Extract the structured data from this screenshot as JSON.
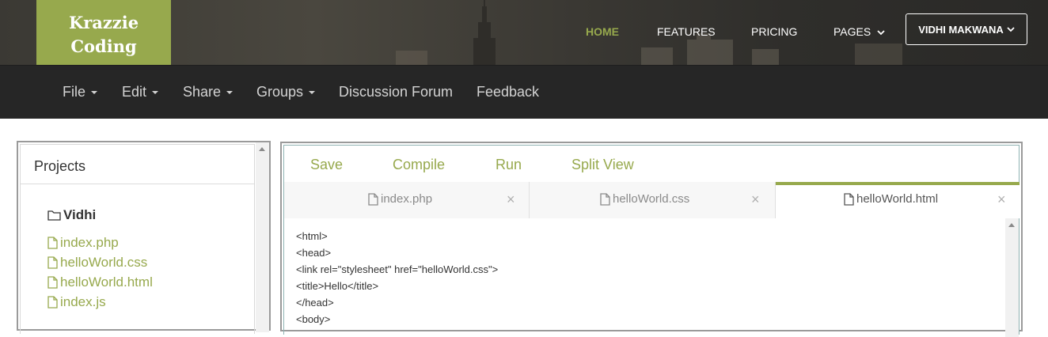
{
  "header": {
    "logo_line1": "Krazzie",
    "logo_line2": "Coding",
    "nav": [
      {
        "label": "HOME",
        "active": true
      },
      {
        "label": "FEATURES",
        "active": false
      },
      {
        "label": "PRICING",
        "active": false
      },
      {
        "label": "PAGES",
        "active": false
      }
    ],
    "user_label": "VIDHI MAKWANA",
    "accent_color": "#97a94d"
  },
  "menu": {
    "items": [
      {
        "label": "File",
        "has_dropdown": true
      },
      {
        "label": "Edit",
        "has_dropdown": true
      },
      {
        "label": "Share",
        "has_dropdown": true
      },
      {
        "label": "Groups",
        "has_dropdown": true
      },
      {
        "label": "Discussion Forum",
        "has_dropdown": false
      },
      {
        "label": "Feedback",
        "has_dropdown": false
      }
    ]
  },
  "projects": {
    "title": "Projects",
    "folder": "Vidhi",
    "files": [
      "index.php",
      "helloWorld.css",
      "helloWorld.html",
      "index.js"
    ]
  },
  "editor": {
    "toolbar": {
      "save": "Save",
      "compile": "Compile",
      "run": "Run",
      "split_view": "Split View"
    },
    "tabs": [
      {
        "label": "index.php",
        "active": false
      },
      {
        "label": "helloWorld.css",
        "active": false
      },
      {
        "label": "helloWorld.html",
        "active": true
      }
    ],
    "close_glyph": "×",
    "code_lines": [
      "<html>",
      "<head>",
      "<link rel=\"stylesheet\" href=\"helloWorld.css\">",
      "<title>Hello</title>",
      "</head>",
      "<body>"
    ]
  },
  "icons": {
    "folder": "folder-icon",
    "file": "file-icon",
    "caret": "caret-down-icon"
  }
}
